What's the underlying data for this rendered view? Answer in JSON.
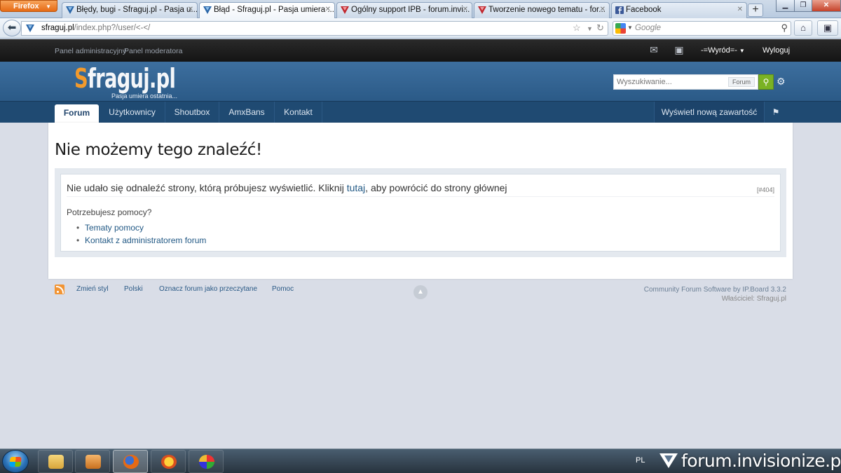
{
  "browser": {
    "menu_button": "Firefox",
    "tabs": [
      {
        "title": "Błędy, bugi - Sfraguj.pl - Pasja u...",
        "favicon": "sfraguj-favicon",
        "active": false
      },
      {
        "title": "Błąd - Sfraguj.pl - Pasja umiera ...",
        "favicon": "sfraguj-favicon",
        "active": true
      },
      {
        "title": "Ogólny support IPB - forum.invi...",
        "favicon": "invisionize-favicon",
        "active": false
      },
      {
        "title": "Tworzenie nowego tematu - for...",
        "favicon": "invisionize-favicon",
        "active": false
      },
      {
        "title": "Facebook",
        "favicon": "facebook-favicon",
        "active": false
      }
    ],
    "new_tab": "+",
    "url_domain": "sfraguj.pl",
    "url_path": "/index.php?/user/<-</",
    "search_placeholder": "Google"
  },
  "admin_bar": {
    "links": [
      "Panel administracyjny",
      "Panel moderatora"
    ],
    "username": "-=Wyród=-",
    "logout": "Wyloguj"
  },
  "header": {
    "logo_s": "S",
    "logo_rest": "fraguj.pl",
    "tagline": "Pasja umiera ostatnia...",
    "search_placeholder": "Wyszukiwanie...",
    "search_scope": "Forum"
  },
  "nav": {
    "items": [
      "Forum",
      "Użytkownicy",
      "Shoutbox",
      "AmxBans",
      "Kontakt"
    ],
    "active_index": 0,
    "new_content": "Wyświetl nową zawartość"
  },
  "error": {
    "title": "Nie możemy tego znaleźć!",
    "message_pre": "Nie udało się odnaleźć strony, którą próbujesz wyświetlić. Kliknij ",
    "message_link": "tutaj",
    "message_post": ", aby powrócić do strony głównej",
    "code": "[#404]",
    "help_title": "Potrzebujesz pomocy?",
    "help_links": [
      "Tematy pomocy",
      "Kontakt z administratorem forum"
    ]
  },
  "footer": {
    "links": [
      "Zmień styl",
      "Polski",
      "Oznacz forum jako przeczytane",
      "Pomoc"
    ],
    "powered_by": "Community Forum Software by IP.Board 3.3.2",
    "owner": "Właściciel: Sfraguj.pl"
  },
  "taskbar": {
    "lang": "PL",
    "watermark": "forum.invisionize.pl"
  }
}
